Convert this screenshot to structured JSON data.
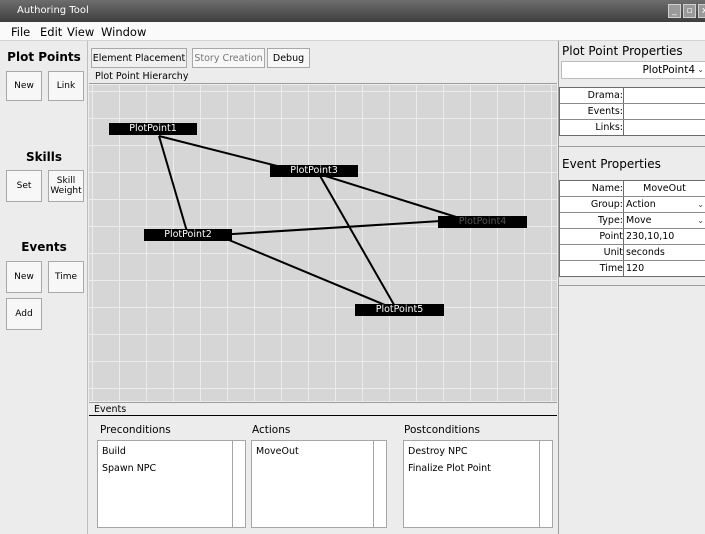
{
  "window": {
    "title": "Authoring Tool",
    "minimize": "_",
    "restore": "▫",
    "close": "x"
  },
  "menu": [
    "File",
    "Edit",
    "View",
    "Window"
  ],
  "left_panel": {
    "plot_points": {
      "title": "Plot Points",
      "new": "New",
      "link": "Link"
    },
    "skills": {
      "title": "Skills",
      "set": "Set",
      "skill_weight_1": "Skill",
      "skill_weight_2": "Weight"
    },
    "events": {
      "title": "Events",
      "new": "New",
      "time": "Time",
      "add": "Add"
    }
  },
  "tabs": [
    "Element Placement",
    "Story Creation",
    "Debug"
  ],
  "hierarchy": {
    "label": "Plot Point Hierarchy",
    "nodes": [
      "PlotPoint1",
      "PlotPoint2",
      "PlotPoint3",
      "PlotPoint4",
      "PlotPoint5"
    ],
    "edges": [
      [
        "PlotPoint1",
        "PlotPoint2"
      ],
      [
        "PlotPoint1",
        "PlotPoint3"
      ],
      [
        "PlotPoint3",
        "PlotPoint4"
      ],
      [
        "PlotPoint3",
        "PlotPoint5"
      ],
      [
        "PlotPoint2",
        "PlotPoint4"
      ],
      [
        "PlotPoint2",
        "PlotPoint5"
      ]
    ]
  },
  "events_panel": {
    "label": "Events",
    "preconditions": {
      "title": "Preconditions",
      "items": [
        "Build",
        "Spawn NPC"
      ]
    },
    "actions": {
      "title": "Actions",
      "items": [
        "MoveOut"
      ]
    },
    "postconditions": {
      "title": "Postconditions",
      "items": [
        "Destroy NPC",
        "Finalize Plot Point"
      ]
    }
  },
  "plot_point_properties": {
    "title": "Plot Point Properties",
    "selected": "PlotPoint4",
    "rows": [
      {
        "label": "Drama:",
        "value": ""
      },
      {
        "label": "Events:",
        "value": ""
      },
      {
        "label": "Links:",
        "value": ""
      }
    ]
  },
  "event_properties": {
    "title": "Event Properties",
    "rows": [
      {
        "label": "Name:",
        "value": "MoveOut"
      },
      {
        "label": "Group:",
        "value": "Action"
      },
      {
        "label": "Type:",
        "value": "Move"
      },
      {
        "label": "Point",
        "value": "230,10,10"
      },
      {
        "label": "Unit",
        "value": "seconds"
      },
      {
        "label": "Time",
        "value": "120"
      }
    ]
  }
}
